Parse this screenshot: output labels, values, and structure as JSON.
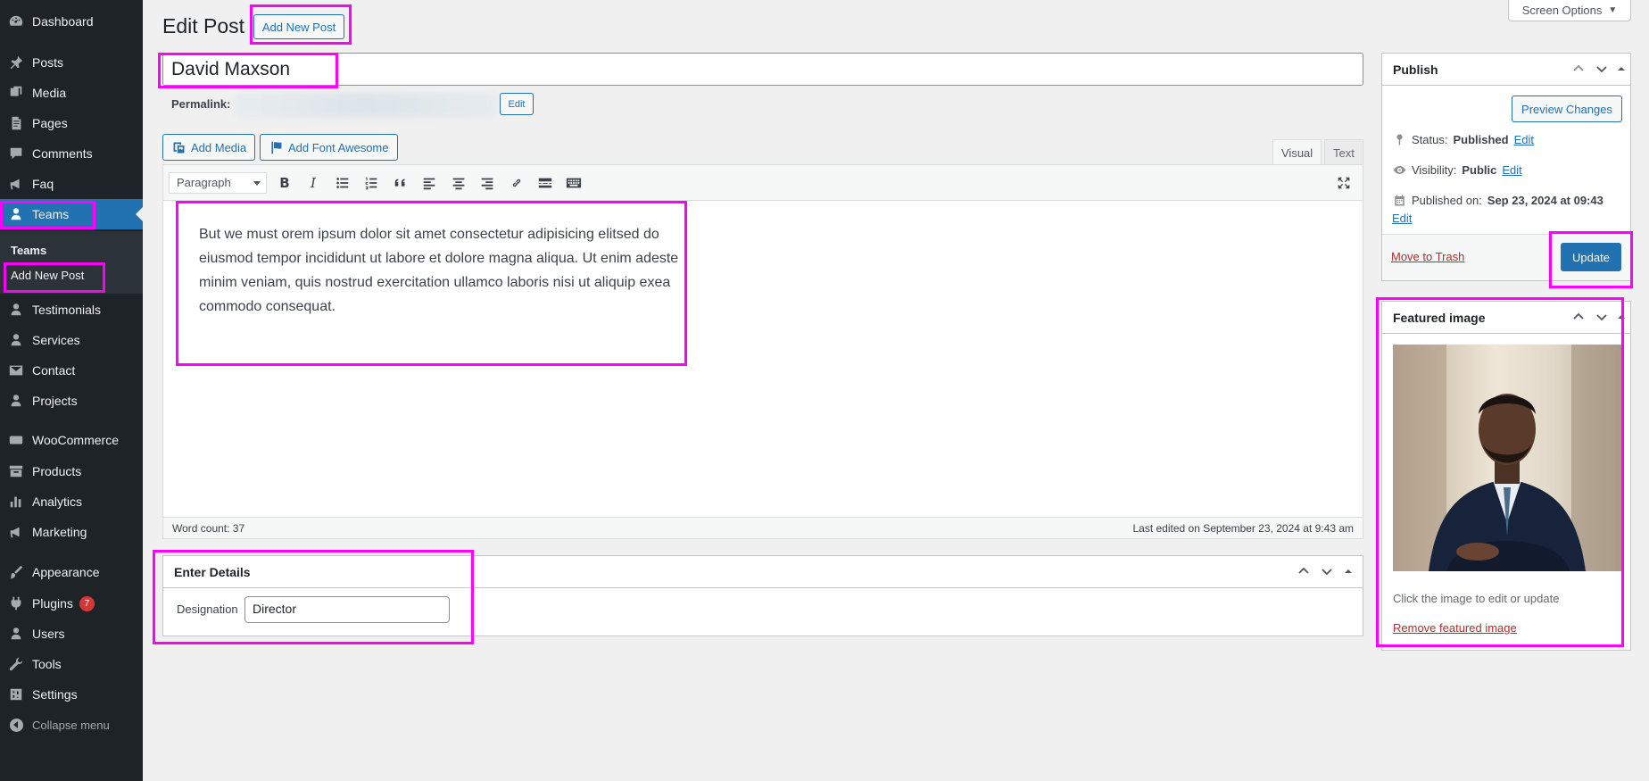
{
  "sidebar": {
    "items": [
      {
        "label": "Dashboard",
        "icon": "dashboard-icon"
      },
      {
        "label": "Posts",
        "icon": "pin-icon"
      },
      {
        "label": "Media",
        "icon": "media-icon"
      },
      {
        "label": "Pages",
        "icon": "pages-icon"
      },
      {
        "label": "Comments",
        "icon": "comments-icon"
      },
      {
        "label": "Faq",
        "icon": "megaphone-icon"
      },
      {
        "label": "Teams",
        "icon": "users-icon"
      },
      {
        "label": "Testimonials",
        "icon": "users-icon"
      },
      {
        "label": "Services",
        "icon": "users-icon"
      },
      {
        "label": "Contact",
        "icon": "mail-icon"
      },
      {
        "label": "Projects",
        "icon": "users-icon"
      },
      {
        "label": "WooCommerce",
        "icon": "woo-icon"
      },
      {
        "label": "Products",
        "icon": "archive-icon"
      },
      {
        "label": "Analytics",
        "icon": "chart-bar-icon"
      },
      {
        "label": "Marketing",
        "icon": "megaphone-icon"
      },
      {
        "label": "Appearance",
        "icon": "brush-icon"
      },
      {
        "label": "Plugins",
        "icon": "plugin-icon",
        "badge": "7"
      },
      {
        "label": "Users",
        "icon": "user-icon"
      },
      {
        "label": "Tools",
        "icon": "wrench-icon"
      },
      {
        "label": "Settings",
        "icon": "settings-icon"
      }
    ],
    "submenu": {
      "heading": "Teams",
      "add_new": "Add New Post"
    },
    "collapse_label": "Collapse menu"
  },
  "header": {
    "title": "Edit Post",
    "add_new_button": "Add New Post",
    "screen_options": "Screen Options"
  },
  "post": {
    "title_value": "David Maxson",
    "permalink_label": "Permalink:",
    "permalink_edit": "Edit"
  },
  "editor": {
    "add_media": "Add Media",
    "add_font_awesome": "Add Font Awesome",
    "tab_visual": "Visual",
    "tab_text": "Text",
    "format": "Paragraph",
    "content": "But we must orem ipsum dolor sit amet consectetur adipisicing elitsed do eiusmod tempor incididunt ut labore et dolore magna aliqua. Ut enim adeste minim veniam, quis nostrud exercitation ullamco laboris nisi ut aliquip exea commodo consequat.",
    "word_count": "Word count: 37",
    "last_edited": "Last edited on September 23, 2024 at 9:43 am"
  },
  "details": {
    "title": "Enter Details",
    "designation_label": "Designation",
    "designation_value": "Director"
  },
  "publish": {
    "title": "Publish",
    "preview_button": "Preview Changes",
    "status_label": "Status:",
    "status_value": "Published",
    "visibility_label": "Visibility:",
    "visibility_value": "Public",
    "published_label": "Published on:",
    "published_value": "Sep 23, 2024 at 09:43",
    "edit_link": "Edit",
    "trash_link": "Move to Trash",
    "update_button": "Update"
  },
  "featured": {
    "title": "Featured image",
    "caption": "Click the image to edit or update",
    "remove_link": "Remove featured image"
  },
  "colors": {
    "sidebar_bg": "#1d2327",
    "accent": "#2271b1",
    "highlight": "#ff00ff",
    "danger": "#b32d2e"
  }
}
